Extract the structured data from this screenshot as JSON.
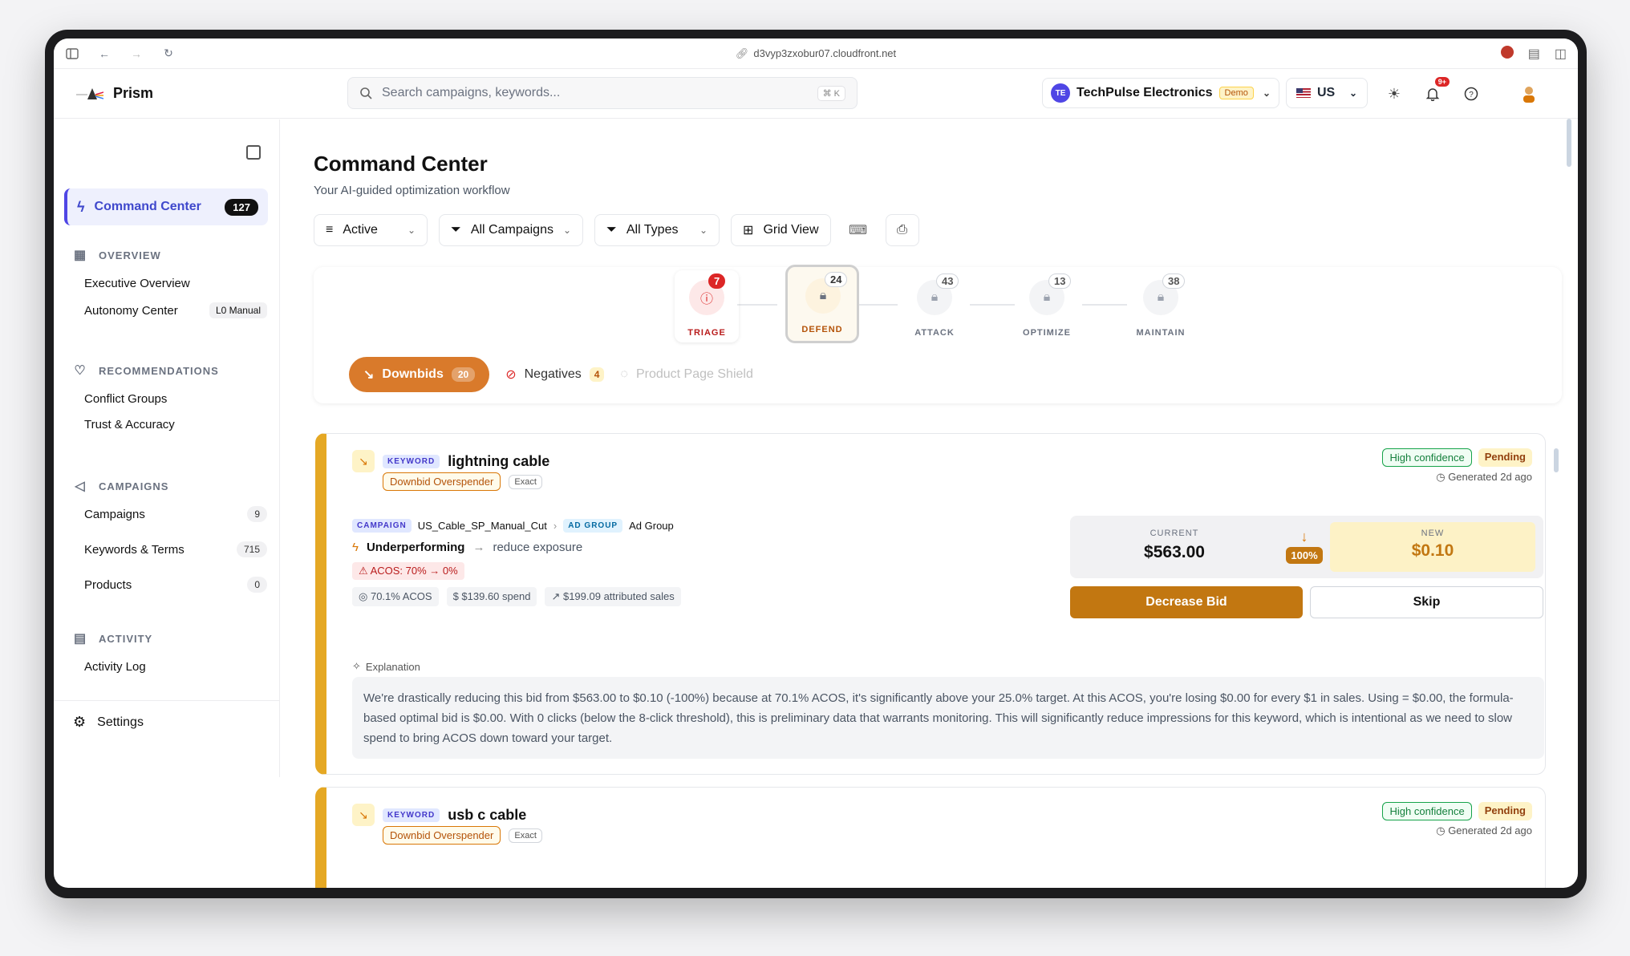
{
  "browser": {
    "url": "d3vyp3zxobur07.cloudfront.net"
  },
  "brand": {
    "name": "Prism"
  },
  "search": {
    "placeholder": "Search campaigns, keywords...",
    "shortcut": "⌘ K"
  },
  "account": {
    "initials": "TE",
    "name": "TechPulse Electronics",
    "badge": "Demo"
  },
  "region": {
    "code": "US"
  },
  "notifications": {
    "count": "9+"
  },
  "sidebar": {
    "active": {
      "label": "Command Center",
      "count": "127"
    },
    "sections": [
      {
        "title": "OVERVIEW",
        "items": [
          {
            "label": "Executive Overview"
          },
          {
            "label": "Autonomy Center",
            "tag": "L0 Manual"
          }
        ]
      },
      {
        "title": "RECOMMENDATIONS",
        "items": [
          {
            "label": "Conflict Groups"
          },
          {
            "label": "Trust & Accuracy"
          }
        ]
      },
      {
        "title": "CAMPAIGNS",
        "items": [
          {
            "label": "Campaigns",
            "count": "9"
          },
          {
            "label": "Keywords & Terms",
            "count": "715"
          },
          {
            "label": "Products",
            "count": "0"
          }
        ]
      },
      {
        "title": "ACTIVITY",
        "items": [
          {
            "label": "Activity Log"
          }
        ]
      }
    ],
    "settings": "Settings"
  },
  "page": {
    "title": "Command Center",
    "subtitle": "Your AI-guided optimization workflow"
  },
  "filters": {
    "status": "Active",
    "campaigns": "All Campaigns",
    "types": "All Types",
    "view": "Grid View"
  },
  "stages": [
    {
      "label": "TRIAGE",
      "count": "7"
    },
    {
      "label": "DEFEND",
      "count": "24"
    },
    {
      "label": "ATTACK",
      "count": "43"
    },
    {
      "label": "OPTIMIZE",
      "count": "13"
    },
    {
      "label": "MAINTAIN",
      "count": "38"
    }
  ],
  "subtabs": [
    {
      "label": "Downbids",
      "count": "20"
    },
    {
      "label": "Negatives",
      "count": "4"
    },
    {
      "label": "Product Page Shield"
    }
  ],
  "cards": [
    {
      "type_label": "KEYWORD",
      "keyword": "lightning cable",
      "tag": "Downbid Overspender",
      "match": "Exact",
      "confidence": "High confidence",
      "status": "Pending",
      "generated": "Generated 2d ago",
      "campaign_label": "CAMPAIGN",
      "campaign": "US_Cable_SP_Manual_Cut",
      "adgroup_label": "AD GROUP",
      "adgroup": "Ad Group",
      "performance": "Underperforming",
      "action": "reduce exposure",
      "acos_change": "ACOS: 70% → 0%",
      "metrics": [
        "70.1% ACOS",
        "$139.60 spend",
        "$199.09 attributed sales"
      ],
      "current_label": "CURRENT",
      "current_bid": "$563.00",
      "change_pct": "100%",
      "new_label": "NEW",
      "new_bid": "$0.10",
      "primary_action": "Decrease Bid",
      "secondary_action": "Skip",
      "explanation_label": "Explanation",
      "explanation": "We're drastically reducing this bid from $563.00 to $0.10 (-100%) because at 70.1% ACOS, it's significantly above your 25.0% target. At this ACOS, you're losing $0.00 for every $1 in sales. Using = $0.00, the formula-based optimal bid is $0.00. With 0 clicks (below the 8-click threshold), this is preliminary data that warrants monitoring. This will significantly reduce impressions for this keyword, which is intentional as we need to slow spend to bring ACOS down toward your target."
    },
    {
      "type_label": "KEYWORD",
      "keyword": "usb c cable",
      "tag": "Downbid Overspender",
      "match": "Exact",
      "confidence": "High confidence",
      "status": "Pending",
      "generated": "Generated 2d ago"
    }
  ],
  "colors": {
    "accent": "#4f46e5",
    "defend": "#c27711",
    "downbid_chip": "#d97a2b",
    "card_border": "#e5a824"
  }
}
